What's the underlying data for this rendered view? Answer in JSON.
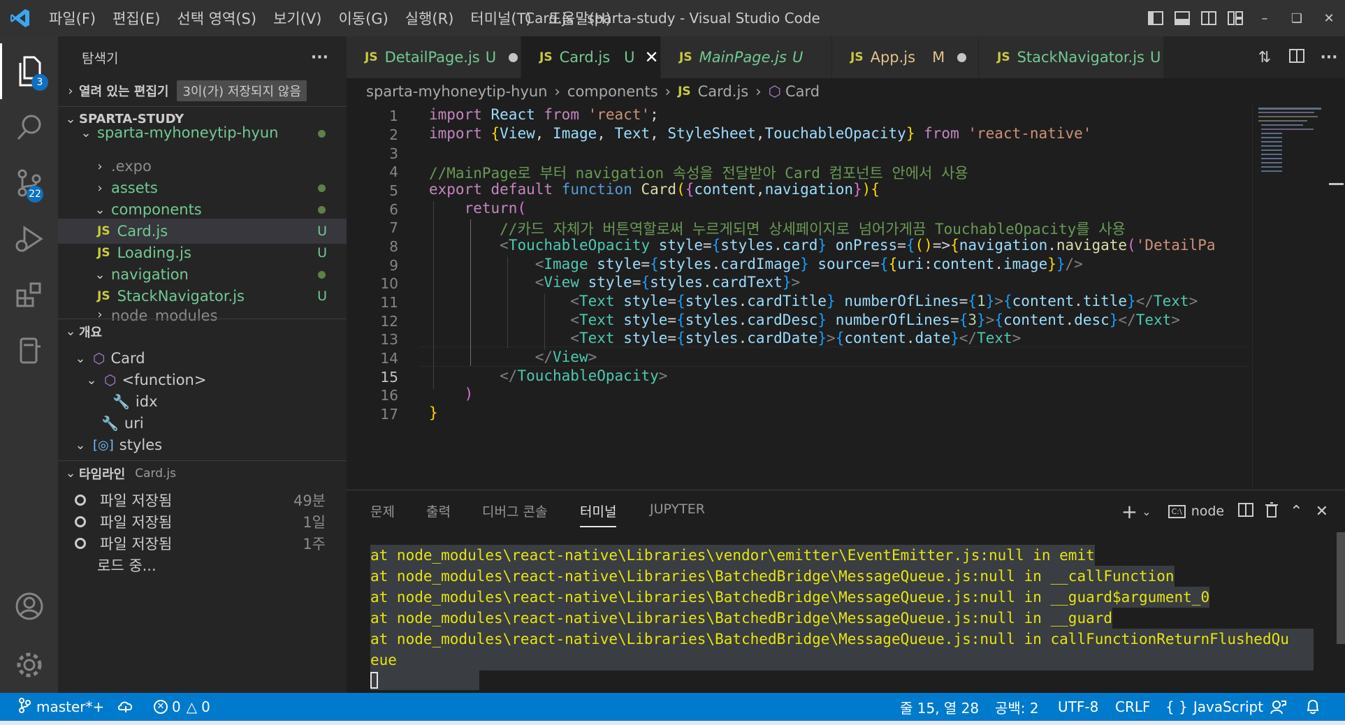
{
  "window": {
    "title": "Card.js - sparta-study - Visual Studio Code"
  },
  "menu": [
    "파일(F)",
    "편집(E)",
    "선택 영역(S)",
    "보기(V)",
    "이동(G)",
    "실행(R)",
    "터미널(T)",
    "도움말(H)"
  ],
  "activity": {
    "explorer_badge": "3",
    "scm_badge": "22"
  },
  "sidebar": {
    "title": "탐색기",
    "more": "···",
    "open_editors": {
      "label": "열려 있는 편집기",
      "badge": "3이(가) 저장되지 않음"
    },
    "workspace": "SPARTA-STUDY",
    "tree": [
      {
        "label": "sparta-myhoneytip-hyun",
        "status": "dot"
      },
      {
        "label": ".expo",
        "status": ""
      },
      {
        "label": "assets",
        "status": "dot"
      },
      {
        "label": "components",
        "status": "dot"
      },
      {
        "label": "Card.js",
        "status": "U"
      },
      {
        "label": "Loading.js",
        "status": "U"
      },
      {
        "label": "navigation",
        "status": "dot"
      },
      {
        "label": "StackNavigator.js",
        "status": "U"
      },
      {
        "label": "node_modules",
        "status": ""
      }
    ],
    "outline": {
      "label": "개요",
      "items": [
        "Card",
        "<function>",
        "idx",
        "uri",
        "styles"
      ]
    },
    "timeline": {
      "label": "타임라인",
      "file": "Card.js",
      "items": [
        {
          "label": "파일 저장됨",
          "time": "49분"
        },
        {
          "label": "파일 저장됨",
          "time": "1일"
        },
        {
          "label": "파일 저장됨",
          "time": "1주"
        }
      ],
      "loading": "로드 중..."
    }
  },
  "tabs": [
    {
      "name": "DetailPage.js",
      "status": "U"
    },
    {
      "name": "Card.js",
      "status": "U"
    },
    {
      "name": "MainPage.js",
      "status": "U"
    },
    {
      "name": "App.js",
      "status": "M"
    },
    {
      "name": "StackNavigator.js",
      "status": "U"
    }
  ],
  "tab_icon": "JS",
  "breadcrumb": [
    "sparta-myhoneytip-hyun",
    "components",
    "Card.js",
    "Card"
  ],
  "editor": {
    "line_numbers": [
      "1",
      "2",
      "3",
      "4",
      "5",
      "6",
      "7",
      "8",
      "9",
      "10",
      "11",
      "12",
      "13",
      "14",
      "15",
      "16",
      "17"
    ],
    "current_line": "15"
  },
  "panel": {
    "tabs": [
      "문제",
      "출력",
      "디버그 콘솔",
      "터미널",
      "JUPYTER"
    ],
    "active_tab": "터미널",
    "terminal_name": "node",
    "terminal_lines": [
      "at node_modules\\react-native\\Libraries\\vendor\\emitter\\EventEmitter.js:null in emit",
      "at node_modules\\react-native\\Libraries\\BatchedBridge\\MessageQueue.js:null in __callFunction",
      "at node_modules\\react-native\\Libraries\\BatchedBridge\\MessageQueue.js:null in __guard$argument_0",
      "at node_modules\\react-native\\Libraries\\BatchedBridge\\MessageQueue.js:null in __guard",
      "at node_modules\\react-native\\Libraries\\BatchedBridge\\MessageQueue.js:null in callFunctionReturnFlushedQu",
      "eue"
    ]
  },
  "status": {
    "branch": "master*+",
    "errors": "0",
    "warnings": "0",
    "position": "줄 15, 열 28",
    "spaces": "공백: 2",
    "encoding": "UTF-8",
    "eol": "CRLF",
    "language": "JavaScript"
  }
}
